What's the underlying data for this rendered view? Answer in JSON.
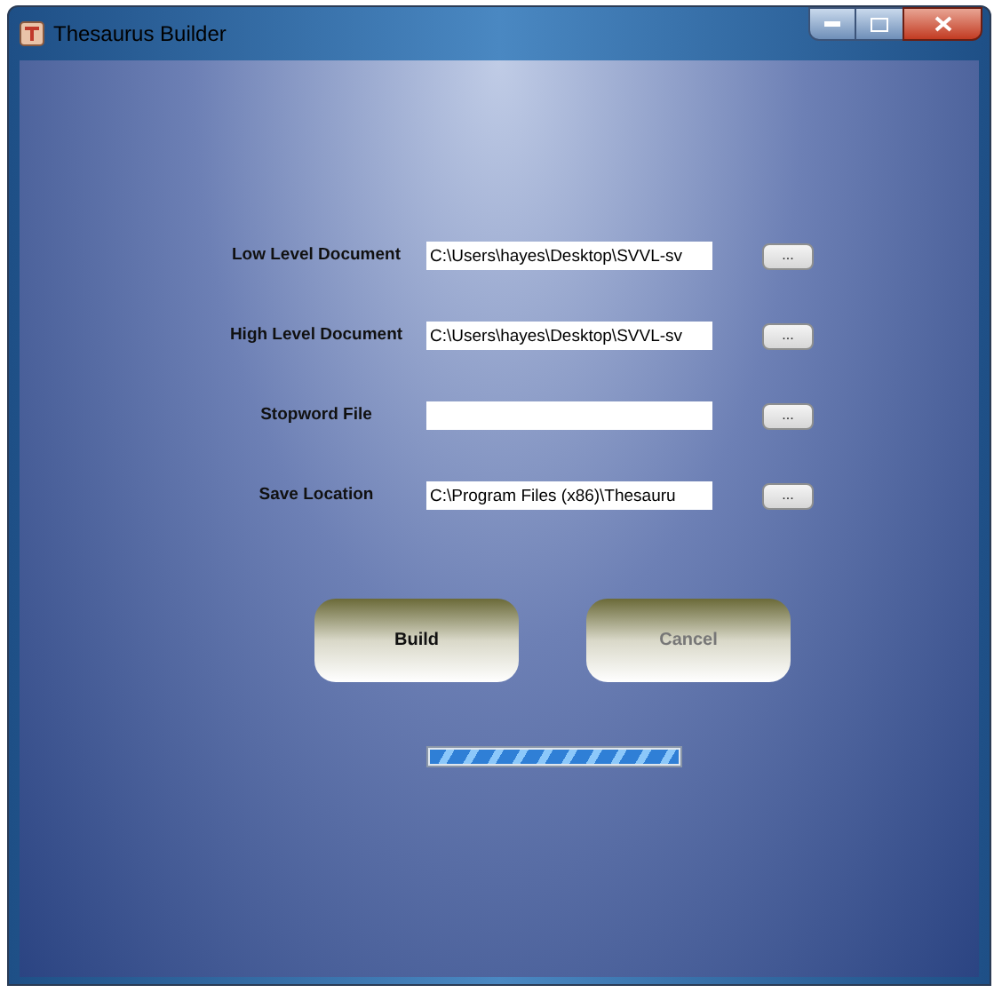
{
  "window": {
    "title": "Thesaurus Builder"
  },
  "fields": [
    {
      "label": "Low Level Document",
      "value": "C:\\Users\\hayes\\Desktop\\SVVL-sv",
      "browse": "..."
    },
    {
      "label": "High Level Document",
      "value": "C:\\Users\\hayes\\Desktop\\SVVL-sv",
      "browse": "..."
    },
    {
      "label": "Stopword File",
      "browse": "..."
    },
    {
      "label": "Save Location",
      "value": "C:\\Program Files (x86)\\Thesauru",
      "browse": "..."
    }
  ],
  "buttons": [
    {
      "label": "Build",
      "disabled": false
    },
    {
      "label": "Cancel",
      "disabled": true
    }
  ],
  "progress": {
    "level": 1
  }
}
